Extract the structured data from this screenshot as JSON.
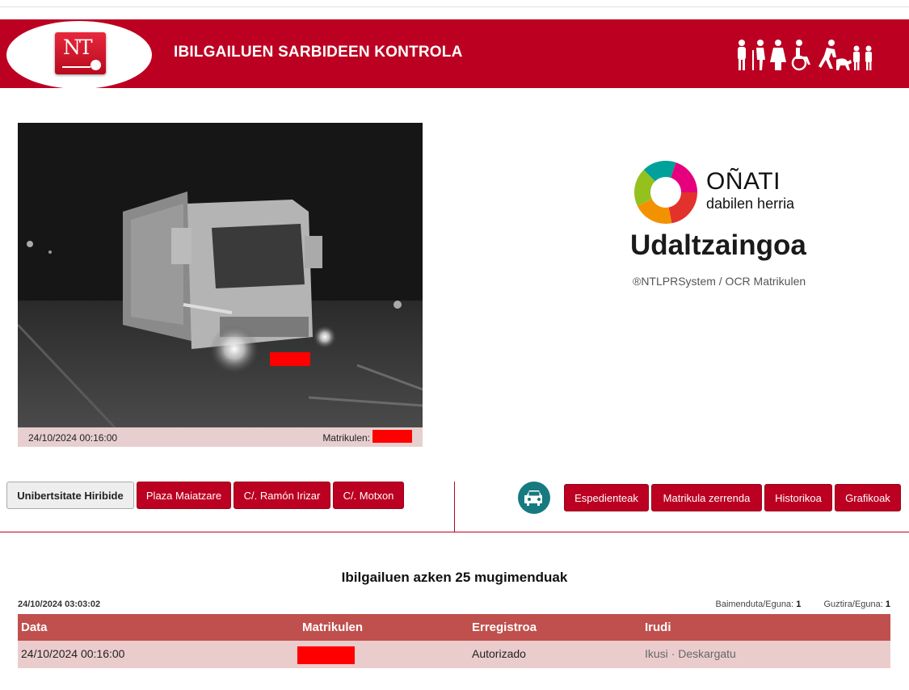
{
  "header": {
    "title": "IBILGAILUEN SARBIDEEN KONTROLA",
    "logo_text": "NT"
  },
  "camera": {
    "timestamp": "24/10/2024 00:16:00",
    "plate_label": "Matrikulen:"
  },
  "brand": {
    "logo_name": "OÑATI",
    "logo_sub": "dabilen herria",
    "department": "Udaltzaingoa",
    "system": "®NTLPRSystem / OCR Matrikulen"
  },
  "locations": [
    {
      "label": "Unibertsitate Hiribide",
      "active": true
    },
    {
      "label": "Plaza Maiatzare",
      "active": false
    },
    {
      "label": "C/. Ramón Irizar",
      "active": false
    },
    {
      "label": "C/. Motxon",
      "active": false
    }
  ],
  "actions": [
    {
      "label": "Espedienteak"
    },
    {
      "label": "Matrikula zerrenda"
    },
    {
      "label": "Historikoa"
    },
    {
      "label": "Grafikoak"
    }
  ],
  "movements": {
    "title": "Ibilgailuen azken 25 mugimenduak",
    "timestamp": "24/10/2024 03:03:02",
    "authorized_label": "Baimenduta/Eguna:",
    "authorized_count": "1",
    "total_label": "Guztira/Eguna:",
    "total_count": "1",
    "columns": [
      "Data",
      "Matrikulen",
      "Erregistroa",
      "Irudi"
    ],
    "rows": [
      {
        "date": "24/10/2024 00:16:00",
        "status": "Autorizado",
        "view": "Ikusi",
        "sep": "·",
        "download": "Deskargatu"
      }
    ]
  },
  "colors": {
    "brand_red": "#bc0021",
    "table_header": "#c0504d",
    "table_row": "#ebcccc",
    "car_icon": "#167a80"
  }
}
